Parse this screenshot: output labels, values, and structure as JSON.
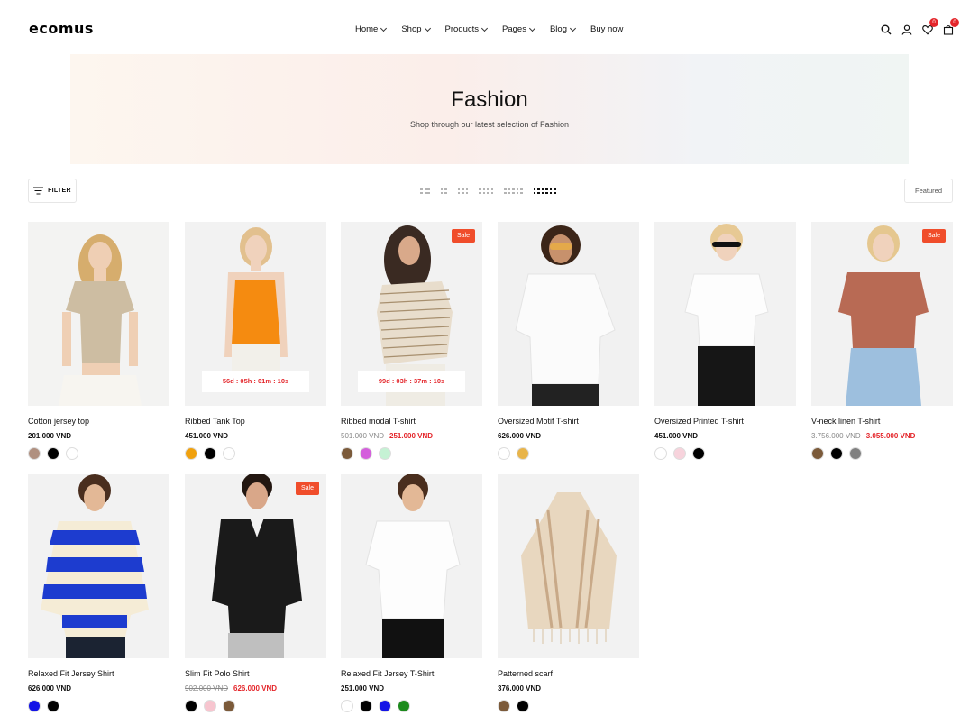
{
  "brand": {
    "logo": "ecomus"
  },
  "nav": [
    {
      "label": "Home"
    },
    {
      "label": "Shop"
    },
    {
      "label": "Products"
    },
    {
      "label": "Pages"
    },
    {
      "label": "Blog"
    },
    {
      "label": "Buy now"
    }
  ],
  "header_icons": {
    "wishlist_count": "0",
    "cart_count": "0"
  },
  "hero": {
    "title": "Fashion",
    "subtitle": "Shop through our latest selection of Fashion"
  },
  "toolbar": {
    "filter_label": "FILTER",
    "sort_label": "Featured"
  },
  "products": [
    {
      "name": "Cotton jersey top",
      "price": "201.000 VND",
      "old_price": "",
      "sale_price": "",
      "badge": "",
      "countdown": "",
      "swatches": [
        "#b09080",
        "#000000",
        "#ffffff"
      ]
    },
    {
      "name": "Ribbed Tank Top",
      "price": "451.000 VND",
      "old_price": "",
      "sale_price": "",
      "badge": "",
      "countdown": "56d : 05h : 01m : 10s",
      "swatches": [
        "#f0a10e",
        "#000000",
        "#ffffff"
      ]
    },
    {
      "name": "Ribbed modal T-shirt",
      "price": "",
      "old_price": "501.000 VND",
      "sale_price": "251.000 VND",
      "badge": "Sale",
      "countdown": "99d : 03h : 37m : 10s",
      "swatches": [
        "#7b5a3a",
        "#d45fdc",
        "#c5f2d4"
      ]
    },
    {
      "name": "Oversized Motif T-shirt",
      "price": "626.000 VND",
      "old_price": "",
      "sale_price": "",
      "badge": "",
      "countdown": "",
      "swatches": [
        "#ffffff",
        "#e8b44a"
      ]
    },
    {
      "name": "Oversized Printed T-shirt",
      "price": "451.000 VND",
      "old_price": "",
      "sale_price": "",
      "badge": "",
      "countdown": "",
      "swatches": [
        "#ffffff",
        "#f7d3dc",
        "#000000"
      ]
    },
    {
      "name": "V-neck linen T-shirt",
      "price": "",
      "old_price": "3.756.000 VND",
      "sale_price": "3.055.000 VND",
      "badge": "Sale",
      "countdown": "",
      "swatches": [
        "#7b5a3a",
        "#000000",
        "#808080"
      ]
    },
    {
      "name": "Relaxed Fit Jersey Shirt",
      "price": "626.000 VND",
      "old_price": "",
      "sale_price": "",
      "badge": "",
      "countdown": "",
      "swatches": [
        "#1414e6",
        "#000000"
      ]
    },
    {
      "name": "Slim Fit Polo Shirt",
      "price": "",
      "old_price": "902.000 VND",
      "sale_price": "626.000 VND",
      "badge": "Sale",
      "countdown": "",
      "swatches": [
        "#000000",
        "#f7c5cf",
        "#7b5a3a"
      ]
    },
    {
      "name": "Relaxed Fit Jersey T-Shirt",
      "price": "251.000 VND",
      "old_price": "",
      "sale_price": "",
      "badge": "",
      "countdown": "",
      "swatches": [
        "#ffffff",
        "#000000",
        "#1414e6",
        "#1c8a1c"
      ]
    },
    {
      "name": "Patterned scarf",
      "price": "376.000 VND",
      "old_price": "",
      "sale_price": "",
      "badge": "",
      "countdown": "",
      "swatches": [
        "#7b5a3a",
        "#000000"
      ]
    }
  ],
  "colors": {
    "accent": "#e4252a",
    "sale_badge": "#f04d2b"
  }
}
